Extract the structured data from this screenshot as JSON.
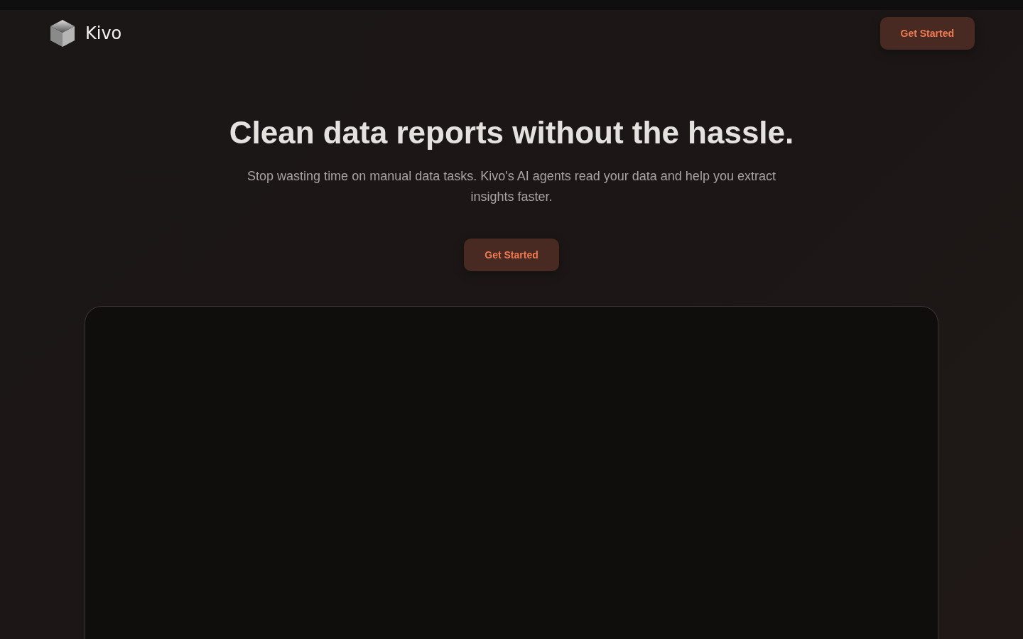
{
  "header": {
    "brand": "Kivo",
    "cta": "Get Started"
  },
  "hero": {
    "title": "Clean data reports without the hassle.",
    "subtitle": "Stop wasting time on manual data tasks. Kivo's AI agents read your data and help you extract insights faster.",
    "cta": "Get Started"
  },
  "preview": {
    "kind": "empty"
  }
}
